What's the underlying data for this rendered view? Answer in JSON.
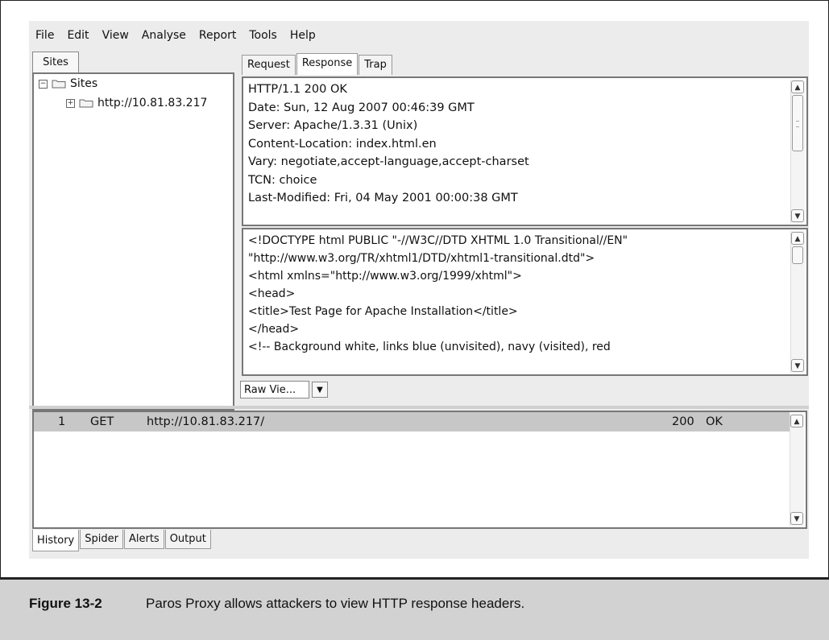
{
  "menu": [
    "File",
    "Edit",
    "View",
    "Analyse",
    "Report",
    "Tools",
    "Help"
  ],
  "sites": {
    "tab_label": "Sites",
    "tree": [
      {
        "label": "Sites",
        "expander": "−"
      },
      {
        "label": "http://10.81.83.217",
        "expander": "+"
      }
    ]
  },
  "tabs": [
    {
      "label": "Request"
    },
    {
      "label": "Response"
    },
    {
      "label": "Trap"
    }
  ],
  "response_header": [
    "HTTP/1.1 200 OK",
    "Date: Sun, 12 Aug 2007 00:46:39 GMT",
    "Server: Apache/1.3.31 (Unix)",
    "Content-Location: index.html.en",
    "Vary: negotiate,accept-language,accept-charset",
    "TCN: choice",
    "Last-Modified: Fri, 04 May 2001 00:00:38 GMT"
  ],
  "response_body": [
    "<!DOCTYPE html PUBLIC \"-//W3C//DTD XHTML 1.0 Transitional//EN\"",
    "   \"http://www.w3.org/TR/xhtml1/DTD/xhtml1-transitional.dtd\">",
    "<html xmlns=\"http://www.w3.org/1999/xhtml\">",
    "<head>",
    "<title>Test Page for Apache Installation</title>",
    "</head>",
    "<!-- Background white, links blue (unvisited), navy (visited), red"
  ],
  "view_select": {
    "value": "Raw Vie..."
  },
  "history": {
    "rows": [
      {
        "id": "1",
        "method": "GET",
        "url": "http://10.81.83.217/",
        "status": "200",
        "reason": "OK"
      }
    ]
  },
  "bottom_tabs": [
    {
      "label": "History"
    },
    {
      "label": "Spider"
    },
    {
      "label": "Alerts"
    },
    {
      "label": "Output"
    }
  ],
  "caption": {
    "label": "Figure 13-2",
    "text": "Paros Proxy allows attackers to view HTTP response headers."
  },
  "icons": {
    "folder": "folder-icon",
    "scroll_up": "chevron-up-icon",
    "scroll_down": "chevron-down-icon",
    "dropdown": "chevron-down-icon"
  },
  "colors": {
    "selected_row": "#c7c7c7",
    "caption_bg": "#d2d2d2",
    "app_bg": "#ececec"
  }
}
